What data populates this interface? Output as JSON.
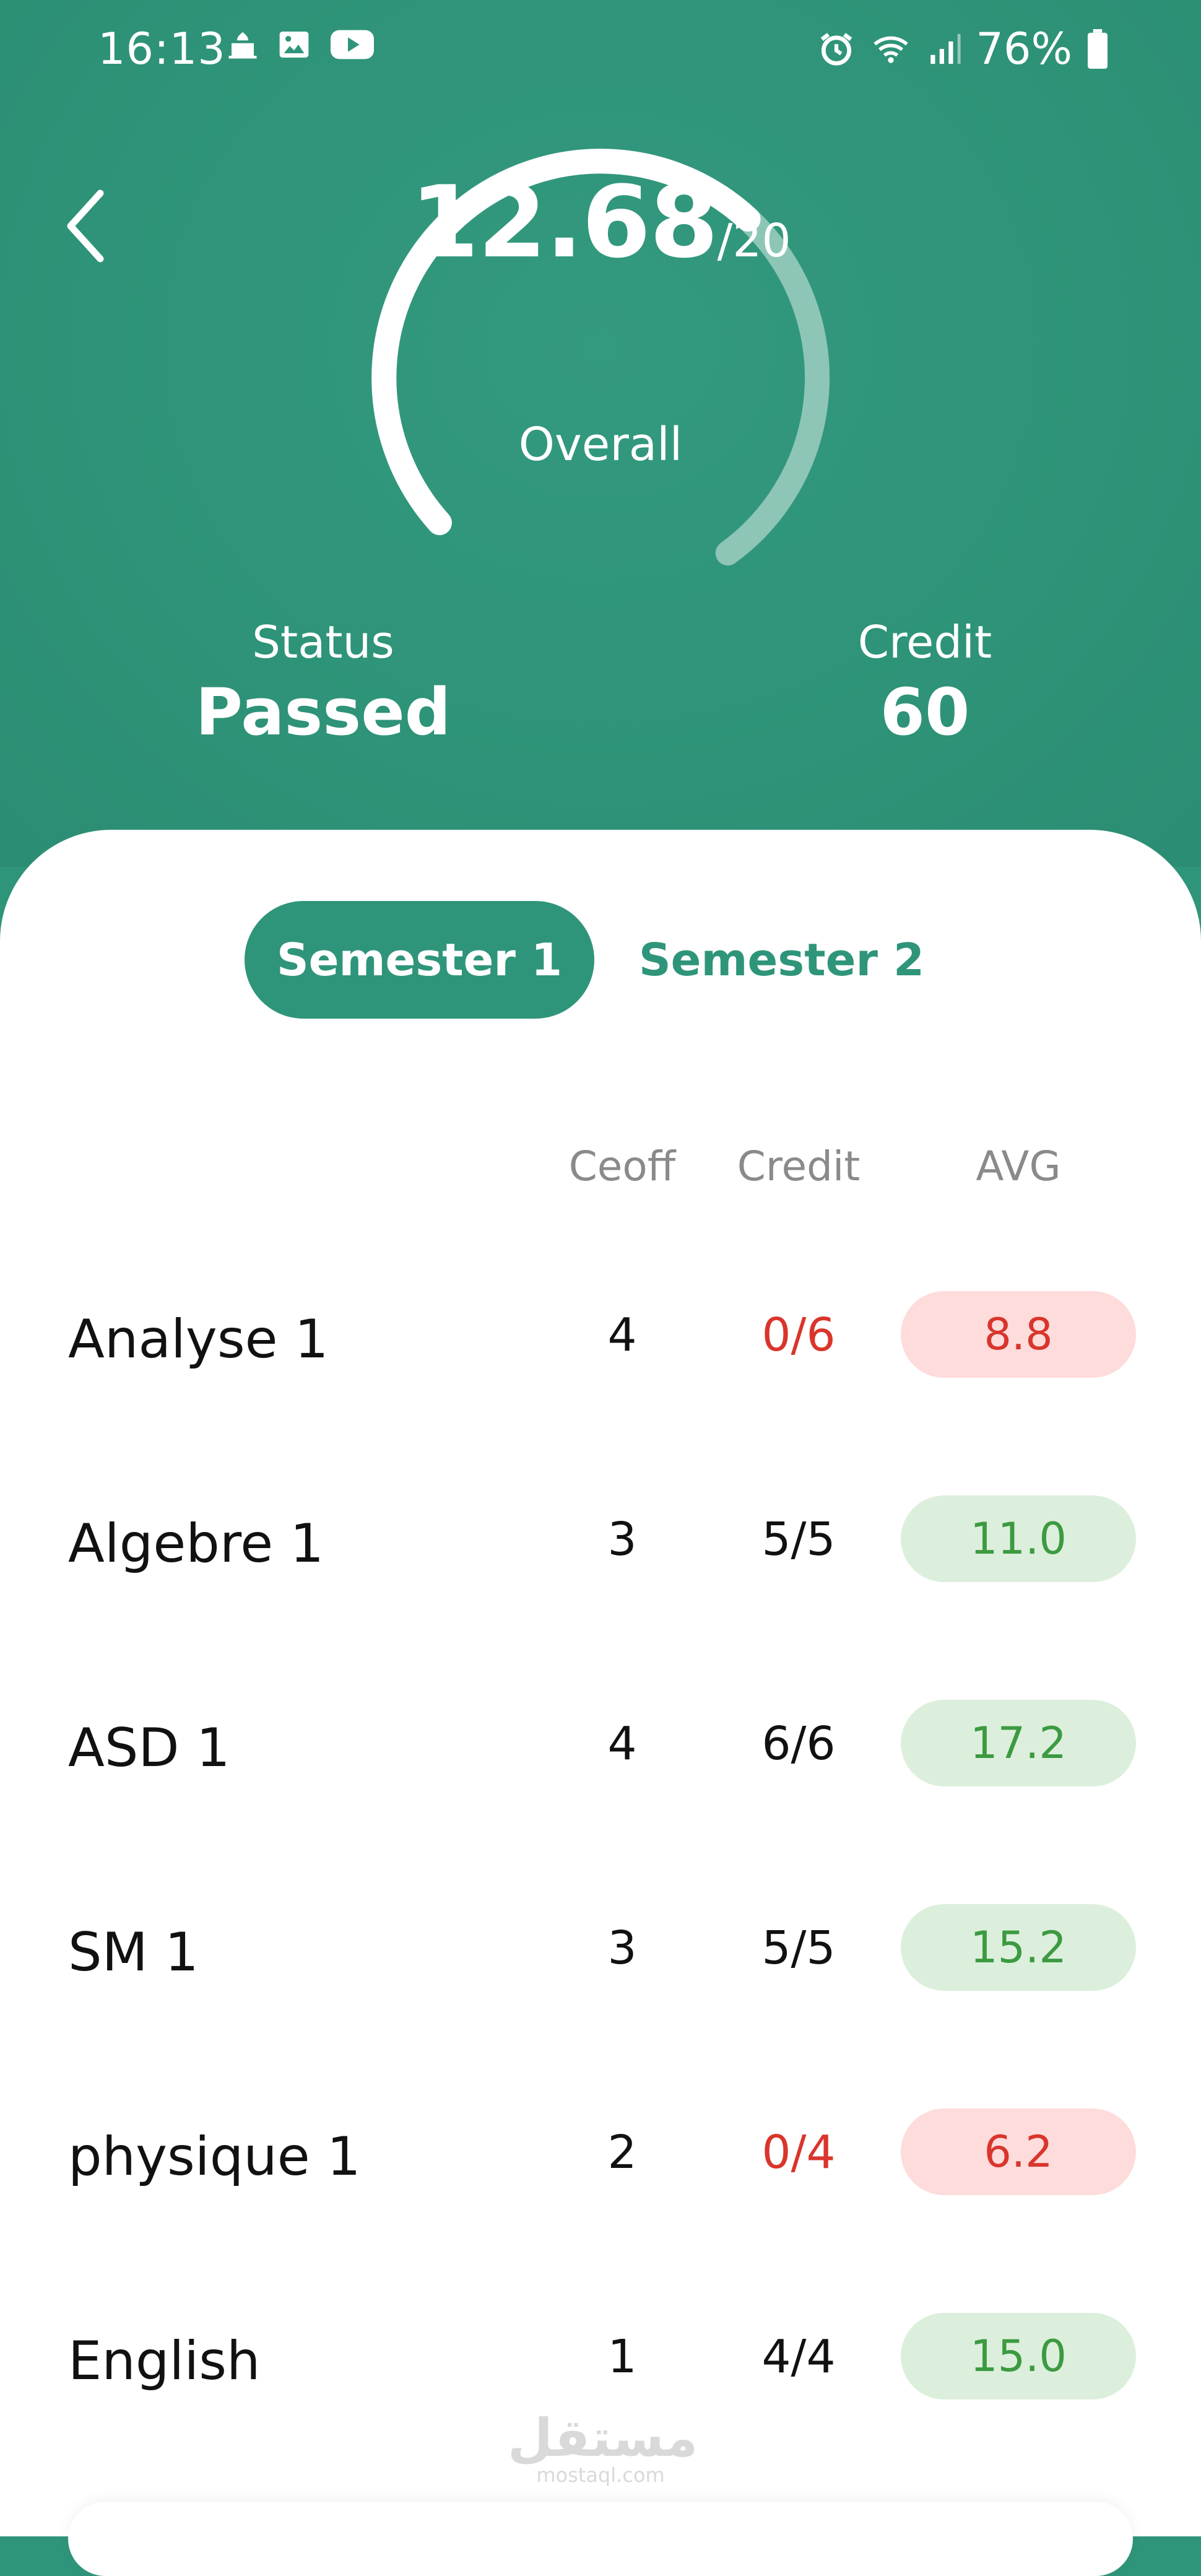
{
  "status_bar": {
    "time": "16:13",
    "left_icons": [
      "mosque-icon",
      "gallery-icon",
      "youtube-icon"
    ],
    "right_icons": [
      "alarm-icon",
      "wifi-icon",
      "signal-icon",
      "battery-icon"
    ],
    "battery": "76%"
  },
  "header": {
    "score": "12.68",
    "score_max": "/20",
    "score_label": "Overall",
    "score_fraction": 0.634,
    "status_label": "Status",
    "status_value": "Passed",
    "credit_label": "Credit",
    "credit_value": "60"
  },
  "tabs": [
    {
      "label": "Semester 1",
      "active": true
    },
    {
      "label": "Semester 2",
      "active": false
    }
  ],
  "columns": {
    "coeff": "Ceoff",
    "credit": "Credit",
    "avg": "AVG"
  },
  "subjects": [
    {
      "name": "Analyse 1",
      "coeff": "4",
      "credit": "0/6",
      "avg": "8.8",
      "passed": false
    },
    {
      "name": "Algebre 1",
      "coeff": "3",
      "credit": "5/5",
      "avg": "11.0",
      "passed": true
    },
    {
      "name": "ASD 1",
      "coeff": "4",
      "credit": "6/6",
      "avg": "17.2",
      "passed": true
    },
    {
      "name": "SM 1",
      "coeff": "3",
      "credit": "5/5",
      "avg": "15.2",
      "passed": true
    },
    {
      "name": "physique 1",
      "coeff": "2",
      "credit": "0/4",
      "avg": "6.2",
      "passed": false
    },
    {
      "name": "English",
      "coeff": "1",
      "credit": "4/4",
      "avg": "15.0",
      "passed": true
    }
  ],
  "watermark": {
    "arabic": "مستقل",
    "latin": "mostaql.com"
  },
  "colors": {
    "primary": "#2f957a",
    "fail_bg": "#fddcdb",
    "fail_text": "#d9352c",
    "pass_bg": "#dcefdc",
    "pass_text": "#3c9a41"
  }
}
